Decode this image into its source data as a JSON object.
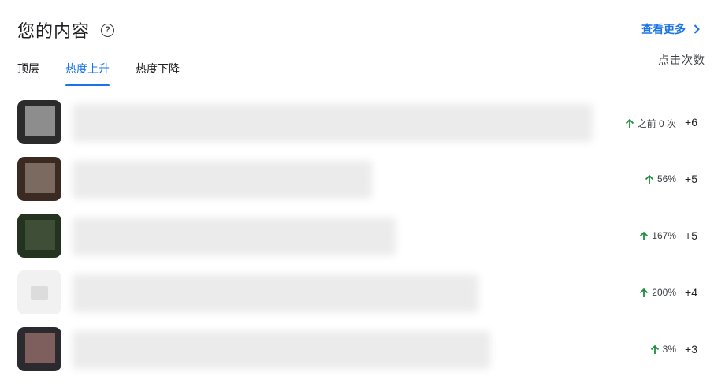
{
  "header": {
    "title": "您的内容",
    "help_glyph": "?",
    "see_more_label": "查看更多"
  },
  "tabs": [
    {
      "label": "顶层",
      "active": false
    },
    {
      "label": "热度上升",
      "active": true
    },
    {
      "label": "热度下降",
      "active": false
    }
  ],
  "column_header": "点击次数",
  "accent_color": "#1a73e8",
  "up_arrow_color": "#1e8e3e",
  "rows": [
    {
      "change": "之前 0 次",
      "clicks": "+6",
      "thumb_icon": "blurred-thumbnail-icon"
    },
    {
      "change": "56%",
      "clicks": "+5",
      "thumb_icon": "blurred-thumbnail-icon"
    },
    {
      "change": "167%",
      "clicks": "+5",
      "thumb_icon": "blurred-thumbnail-icon"
    },
    {
      "change": "200%",
      "clicks": "+4",
      "thumb_icon": "blurred-thumbnail-icon"
    },
    {
      "change": "3%",
      "clicks": "+3",
      "thumb_icon": "blurred-thumbnail-icon"
    }
  ]
}
